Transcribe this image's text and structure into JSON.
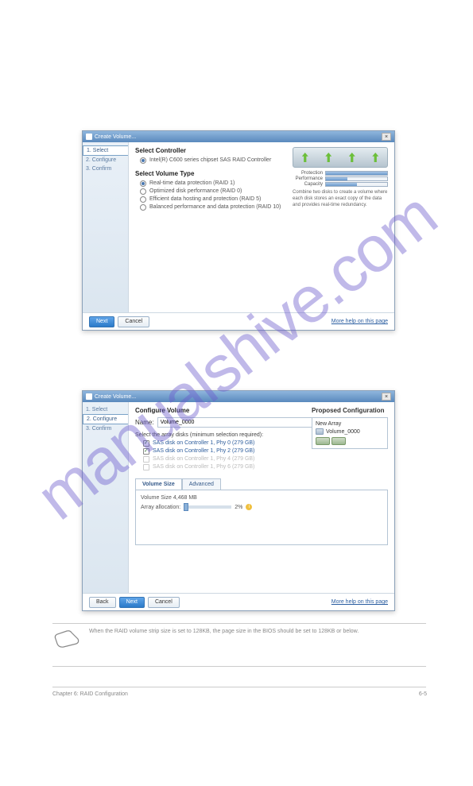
{
  "watermark": "manualshive.com",
  "windows": {
    "w1": {
      "title": "Create Volume...",
      "steps": [
        "1. Select",
        "2. Configure",
        "3. Confirm"
      ],
      "active_step": 0,
      "controller_section": "Select Controller",
      "controller_option": "Intel(R) C600 series chipset SAS RAID Controller",
      "voltype_section": "Select Volume Type",
      "voltype_options": [
        "Real-time data protection (RAID 1)",
        "Optimized disk performance (RAID 0)",
        "Efficient data hosting and protection (RAID 5)",
        "Balanced performance and data protection (RAID 10)"
      ],
      "voltype_selected": 0,
      "meters": {
        "protection": {
          "label": "Protection",
          "pct": 100
        },
        "performance": {
          "label": "Performance",
          "pct": 35
        },
        "capacity": {
          "label": "Capacity",
          "pct": 50
        }
      },
      "desc": "Combine two disks to create a volume where each disk stores an exact copy of the data and provides real-time redundancy.",
      "buttons": {
        "next": "Next",
        "cancel": "Cancel"
      },
      "help": "More help on this page"
    },
    "w2": {
      "title": "Create Volume...",
      "steps": [
        "1. Select",
        "2. Configure",
        "3. Confirm"
      ],
      "active_step": 1,
      "config_section": "Configure Volume",
      "name_label": "Name:",
      "name_value": "Volume_0000",
      "select_disks": "Select the array disks (minimum selection required):",
      "disks": [
        {
          "label": "SAS disk on Controller 1, Phy 0 (279 GB)",
          "on": true
        },
        {
          "label": "SAS disk on Controller 1, Phy 2 (279 GB)",
          "on": true
        },
        {
          "label": "SAS disk on Controller 1, Phy 4 (279 GB)",
          "on": false
        },
        {
          "label": "SAS disk on Controller 1, Phy 6 (279 GB)",
          "on": false
        }
      ],
      "tabs": [
        "Volume Size",
        "Advanced"
      ],
      "active_tab": 0,
      "vol_size_label": "Volume Size 4,468 MB",
      "alloc_label": "Array allocation:",
      "alloc_pct": "2%",
      "proposed_h": "Proposed Configuration",
      "new_array": "New Array",
      "vol_name": "Volume_0000",
      "buttons": {
        "back": "Back",
        "next": "Next",
        "cancel": "Cancel"
      },
      "help": "More help on this page"
    }
  },
  "note": "When the RAID volume strip size is set to 128KB, the page size in the BIOS should be set to 128KB or below.",
  "footer": {
    "chapter": "Chapter 6: RAID Configuration",
    "page": "6-5"
  }
}
